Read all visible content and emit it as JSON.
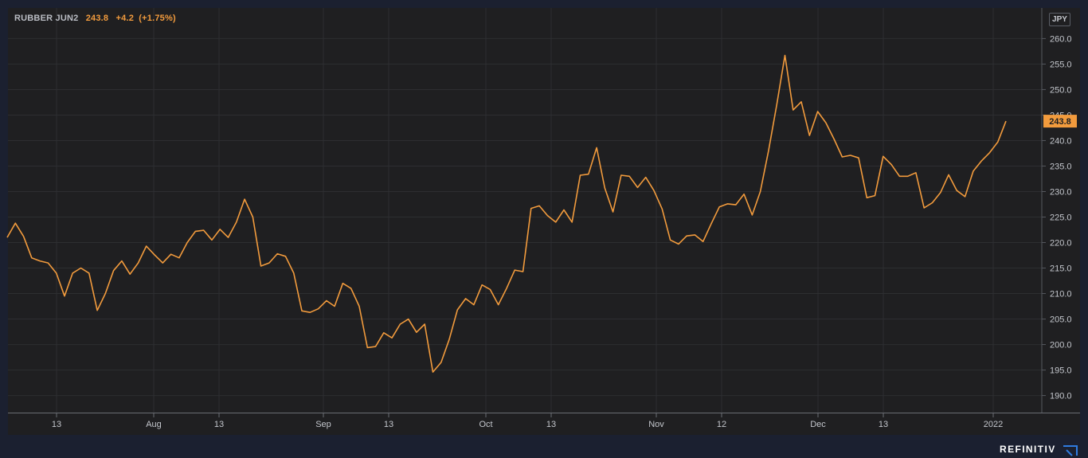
{
  "header": {
    "symbol": "RUBBER JUN2",
    "last": "243.8",
    "change": "+4.2",
    "change_pct": "(+1.75%)"
  },
  "currency": "JPY",
  "brand": "REFINITIV",
  "colors": {
    "background": "#1b2030",
    "plot_background": "#1f1f21",
    "line": "#f29b3d",
    "grid": "#2d2e31",
    "axis_text": "#c3c6cc"
  },
  "chart_data": {
    "type": "line",
    "title": "",
    "xlabel": "",
    "ylabel": "",
    "ylim": [
      186.5,
      266
    ],
    "grid": true,
    "y_ticks": [
      "190.0",
      "195.0",
      "200.0",
      "205.0",
      "210.0",
      "215.0",
      "220.0",
      "225.0",
      "230.0",
      "235.0",
      "240.0",
      "245.0",
      "250.0",
      "255.0",
      "260.0"
    ],
    "x_ticks": [
      "13",
      "Aug",
      "13",
      "Sep",
      "13",
      "Oct",
      "13",
      "Nov",
      "12",
      "Dec",
      "13",
      "2022"
    ],
    "last_value_label": "243.8",
    "series": [
      {
        "values": [
          221.0,
          223.8,
          221.2,
          217.0,
          216.4,
          216.0,
          214.0,
          209.5,
          214.0,
          215.0,
          214.0,
          206.7,
          210.0,
          214.5,
          216.4,
          213.8,
          216.0,
          219.3,
          217.6,
          216.0,
          217.7,
          217.0,
          220.0,
          222.2,
          222.4,
          220.5,
          222.6,
          221.0,
          224.0,
          228.5,
          225.0,
          215.4,
          216.0,
          217.8,
          217.3,
          214.0,
          206.6,
          206.3,
          207.0,
          208.6,
          207.5,
          212.0,
          211.0,
          207.5,
          199.4,
          199.6,
          202.3,
          201.3,
          204.0,
          205.0,
          202.4,
          204.0,
          194.6,
          196.5,
          201.0,
          206.8,
          209.0,
          207.8,
          211.7,
          210.8,
          207.8,
          211.0,
          214.6,
          214.3,
          226.7,
          227.2,
          225.3,
          224.0,
          226.4,
          224.0,
          233.2,
          233.4,
          238.6,
          230.7,
          226.0,
          233.2,
          233.0,
          230.8,
          232.8,
          230.2,
          226.6,
          220.5,
          219.7,
          221.3,
          221.5,
          220.2,
          223.7,
          227.0,
          227.6,
          227.4,
          229.5,
          225.4,
          230.0,
          238.0,
          247.0,
          256.7,
          246.0,
          247.6,
          241.0,
          245.7,
          243.5,
          240.3,
          236.8,
          237.1,
          236.6,
          228.8,
          229.2,
          236.9,
          235.3,
          233.0,
          233.0,
          233.7,
          226.8,
          227.8,
          229.8,
          233.3,
          230.2,
          229.0,
          234.0,
          236.0,
          237.6,
          239.7,
          243.8
        ]
      }
    ]
  }
}
